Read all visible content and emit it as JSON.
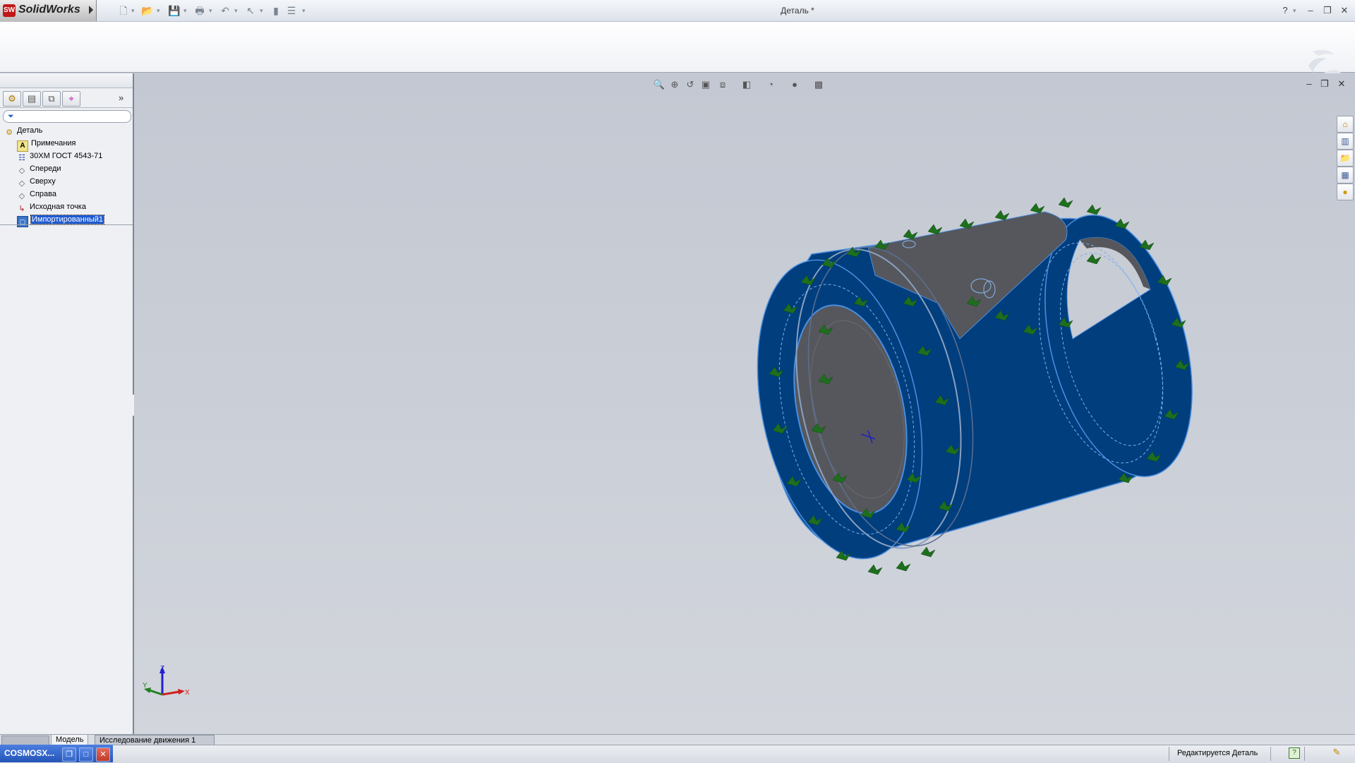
{
  "app": {
    "logo_badge": "SW",
    "logo_text": "SolidWorks",
    "document_title": "Деталь *"
  },
  "title_bar": {
    "help_label": "?",
    "minimize_label": "–",
    "restore_label": "❐",
    "close_label": "✕"
  },
  "feature_tree": {
    "tabs": [
      "feature-manager",
      "property-manager",
      "configuration-manager",
      "dimxpert-manager"
    ],
    "items": [
      {
        "label": "Деталь",
        "icon": "part-icon"
      },
      {
        "label": "Примечания",
        "icon": "annotations-icon"
      },
      {
        "label": "30ХМ ГОСТ 4543-71",
        "icon": "material-icon"
      },
      {
        "label": "Спереди",
        "icon": "plane-icon"
      },
      {
        "label": "Сверху",
        "icon": "plane-icon"
      },
      {
        "label": "Справа",
        "icon": "plane-icon"
      },
      {
        "label": "Исходная точка",
        "icon": "origin-icon"
      },
      {
        "label": "Импортированный1",
        "icon": "imported-body-icon",
        "selected": true
      }
    ]
  },
  "bottom_tabs": {
    "model": "Модель",
    "motion_study": "Исследование движения 1"
  },
  "taskbar": {
    "cosmos_label": "COSMOSX..."
  },
  "status_bar": {
    "status_text": "Редактируется Деталь"
  },
  "triad": {
    "x_label": "X",
    "y_label": "Y",
    "z_label": "Z"
  },
  "colors": {
    "model_body": "#003e7e",
    "model_cut_face": "#56575c",
    "fixture_arrows": "#1e6e1e",
    "selection": "#1f5bd1"
  }
}
